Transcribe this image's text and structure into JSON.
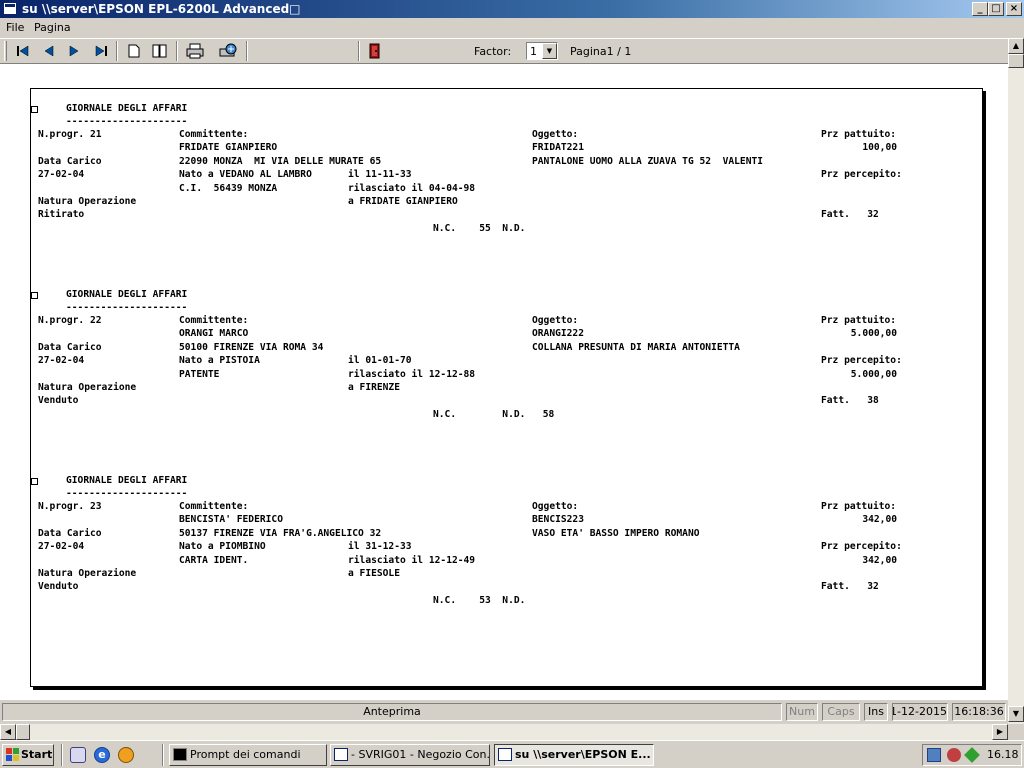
{
  "window": {
    "title": "su \\\\server\\EPSON EPL-6200L Advanced□"
  },
  "menu": {
    "items": [
      "File",
      "Pagina"
    ]
  },
  "toolbar": {
    "factor_label": "Factor:",
    "factor_value": "1",
    "page_label": "Pagina1 / 1",
    "icons": [
      "first-page-icon",
      "prev-page-icon",
      "next-page-icon",
      "last-page-icon",
      "single-page-icon",
      "two-pages-icon",
      "print-icon",
      "print-setup-icon",
      "exit-icon"
    ]
  },
  "report": {
    "entries": [
      {
        "heading": "GIORNALE DEGLI AFFARI",
        "underline": "---------------------",
        "rows": [
          [
            "N.progr. 21",
            "Committente:",
            "",
            "Oggetto:",
            "Prz pattuito:"
          ],
          [
            "",
            "FRIDATE GIANPIERO",
            "",
            "FRIDAT221",
            "100,00"
          ],
          [
            "Data Carico",
            "22090 MONZA  MI VIA DELLE MURATE 65",
            "",
            "PANTALONE UOMO ALLA ZUAVA TG 52  VALENTI",
            ""
          ],
          [
            "27-02-04",
            "Nato a VEDANO AL LAMBRO",
            "il 11-11-33",
            "",
            "Prz percepito:"
          ],
          [
            "",
            "C.I.  56439 MONZA",
            "rilasciato il 04-04-98",
            "",
            ""
          ],
          [
            "Natura Operazione",
            "",
            "a FRIDATE GIANPIERO",
            "",
            ""
          ],
          [
            "Ritirato",
            "",
            "",
            "",
            "Fatt.   32"
          ]
        ],
        "footer": "N.C.    55  N.D."
      },
      {
        "heading": "GIORNALE DEGLI AFFARI",
        "underline": "---------------------",
        "rows": [
          [
            "N.progr. 22",
            "Committente:",
            "",
            "Oggetto:",
            "Prz pattuito:"
          ],
          [
            "",
            "ORANGI MARCO",
            "",
            "ORANGI222",
            "5.000,00"
          ],
          [
            "Data Carico",
            "50100 FIRENZE VIA ROMA 34",
            "",
            "COLLANA PRESUNTA DI MARIA ANTONIETTA",
            ""
          ],
          [
            "27-02-04",
            "Nato a PISTOIA",
            "il 01-01-70",
            "",
            "Prz percepito:"
          ],
          [
            "",
            "PATENTE",
            "rilasciato il 12-12-88",
            "",
            "5.000,00"
          ],
          [
            "Natura Operazione",
            "",
            "a FIRENZE",
            "",
            ""
          ],
          [
            "Venduto",
            "",
            "",
            "",
            "Fatt.   38"
          ]
        ],
        "footer": "N.C.        N.D.   58"
      },
      {
        "heading": "GIORNALE DEGLI AFFARI",
        "underline": "---------------------",
        "rows": [
          [
            "N.progr. 23",
            "Committente:",
            "",
            "Oggetto:",
            "Prz pattuito:"
          ],
          [
            "",
            "BENCISTA' FEDERICO",
            "",
            "BENCIS223",
            "342,00"
          ],
          [
            "Data Carico",
            "50137 FIRENZE VIA FRA'G.ANGELICO 32",
            "",
            "VASO ETA' BASSO IMPERO ROMANO",
            ""
          ],
          [
            "27-02-04",
            "Nato a PIOMBINO",
            "il 31-12-33",
            "",
            "Prz percepito:"
          ],
          [
            "",
            "CARTA IDENT.",
            "rilasciato il 12-12-49",
            "",
            "342,00"
          ],
          [
            "Natura Operazione",
            "",
            "a FIESOLE",
            "",
            ""
          ],
          [
            "Venduto",
            "",
            "",
            "",
            "Fatt.   32"
          ]
        ],
        "footer": "N.C.    53  N.D."
      }
    ]
  },
  "status": {
    "mode": "Anteprima",
    "num": "Num",
    "caps": "Caps",
    "ins": "Ins",
    "date": "01-12-2015",
    "time": "16:18:36"
  },
  "taskbar": {
    "start": "Start",
    "buttons": [
      {
        "label": "Prompt dei comandi",
        "active": false
      },
      {
        "label": "- SVRIG01 - Negozio Con...",
        "active": false
      },
      {
        "label": "su \\\\server\\EPSON E...",
        "active": true
      }
    ],
    "clock": "16.18"
  },
  "colors": {
    "titlebar": "#0a246a",
    "face": "#d4d0c8",
    "paper": "#ffffff"
  }
}
